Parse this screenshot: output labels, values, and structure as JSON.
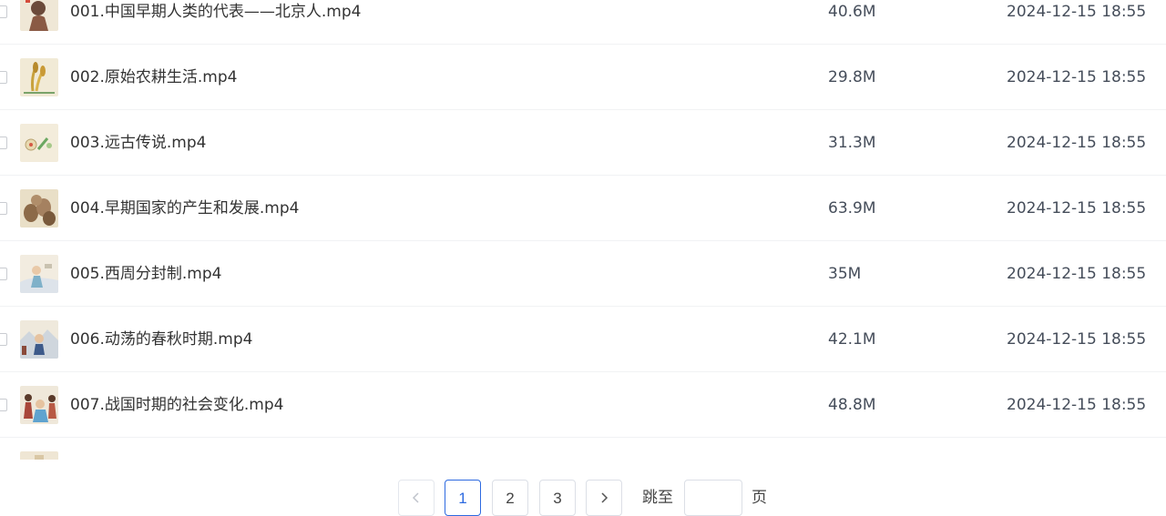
{
  "files": [
    {
      "name": "001.中国早期人类的代表——北京人.mp4",
      "size": "40.6M",
      "date": "2024-12-15 18:55",
      "thumb": "peking-man-thumbnail"
    },
    {
      "name": "002.原始农耕生活.mp4",
      "size": "29.8M",
      "date": "2024-12-15 18:55",
      "thumb": "farming-thumbnail"
    },
    {
      "name": "003.远古传说.mp4",
      "size": "31.3M",
      "date": "2024-12-15 18:55",
      "thumb": "legend-thumbnail"
    },
    {
      "name": "004.早期国家的产生和发展.mp4",
      "size": "63.9M",
      "date": "2024-12-15 18:55",
      "thumb": "pottery-thumbnail"
    },
    {
      "name": "005.西周分封制.mp4",
      "size": "35M",
      "date": "2024-12-15 18:55",
      "thumb": "western-zhou-thumbnail"
    },
    {
      "name": "006.动荡的春秋时期.mp4",
      "size": "42.1M",
      "date": "2024-12-15 18:55",
      "thumb": "spring-autumn-thumbnail"
    },
    {
      "name": "007.战国时期的社会变化.mp4",
      "size": "48.8M",
      "date": "2024-12-15 18:55",
      "thumb": "warring-states-thumbnail"
    }
  ],
  "pagination": {
    "pages": [
      "1",
      "2",
      "3"
    ],
    "current": "1",
    "jump_prefix": "跳至",
    "jump_suffix": "页",
    "jump_value": "",
    "prev_icon": "chevron-left-icon",
    "next_icon": "chevron-right-icon"
  },
  "colors": {
    "accent": "#2d6ae0",
    "border": "#dcdfe6",
    "divider": "#f1f2f4",
    "text": "#333333",
    "muted": "#454d5a"
  }
}
